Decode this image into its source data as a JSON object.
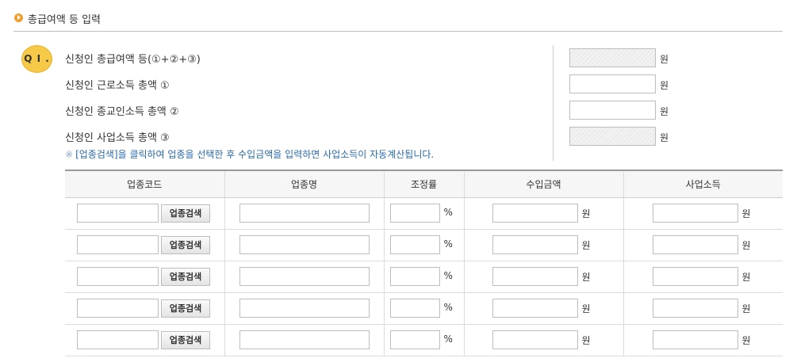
{
  "section": {
    "title": "총급여액 등 입력"
  },
  "question": {
    "badge": "Q I ."
  },
  "summary": {
    "rows": [
      {
        "label": "신청인 총급여액 등(①+②+③)",
        "value": "",
        "unit": "원",
        "readonly": true
      },
      {
        "label": "신청인 근로소득 총액 ①",
        "value": "",
        "unit": "원",
        "readonly": false
      },
      {
        "label": "신청인 종교인소득 총액 ②",
        "value": "",
        "unit": "원",
        "readonly": false
      },
      {
        "label": "신청인 사업소득 총액 ③",
        "value": "",
        "unit": "원",
        "readonly": true
      }
    ]
  },
  "note": {
    "mark": "※",
    "text": "[업종검색]을 클릭하여 업종을 선택한 후 수입금액을 입력하면 사업소득이 자동계산됩니다."
  },
  "table": {
    "headers": [
      "업종코드",
      "업종명",
      "조정률",
      "수입금액",
      "사업소득"
    ],
    "search_button_label": "업종검색",
    "percent_unit": "%",
    "won_unit": "원",
    "rows": [
      {
        "code": "",
        "name": "",
        "rate": "",
        "revenue": "",
        "income": ""
      },
      {
        "code": "",
        "name": "",
        "rate": "",
        "revenue": "",
        "income": ""
      },
      {
        "code": "",
        "name": "",
        "rate": "",
        "revenue": "",
        "income": ""
      },
      {
        "code": "",
        "name": "",
        "rate": "",
        "revenue": "",
        "income": ""
      },
      {
        "code": "",
        "name": "",
        "rate": "",
        "revenue": "",
        "income": ""
      }
    ]
  },
  "colors": {
    "accent": "#f0a030",
    "badge": "#f7c948",
    "note": "#2b6aa9"
  }
}
